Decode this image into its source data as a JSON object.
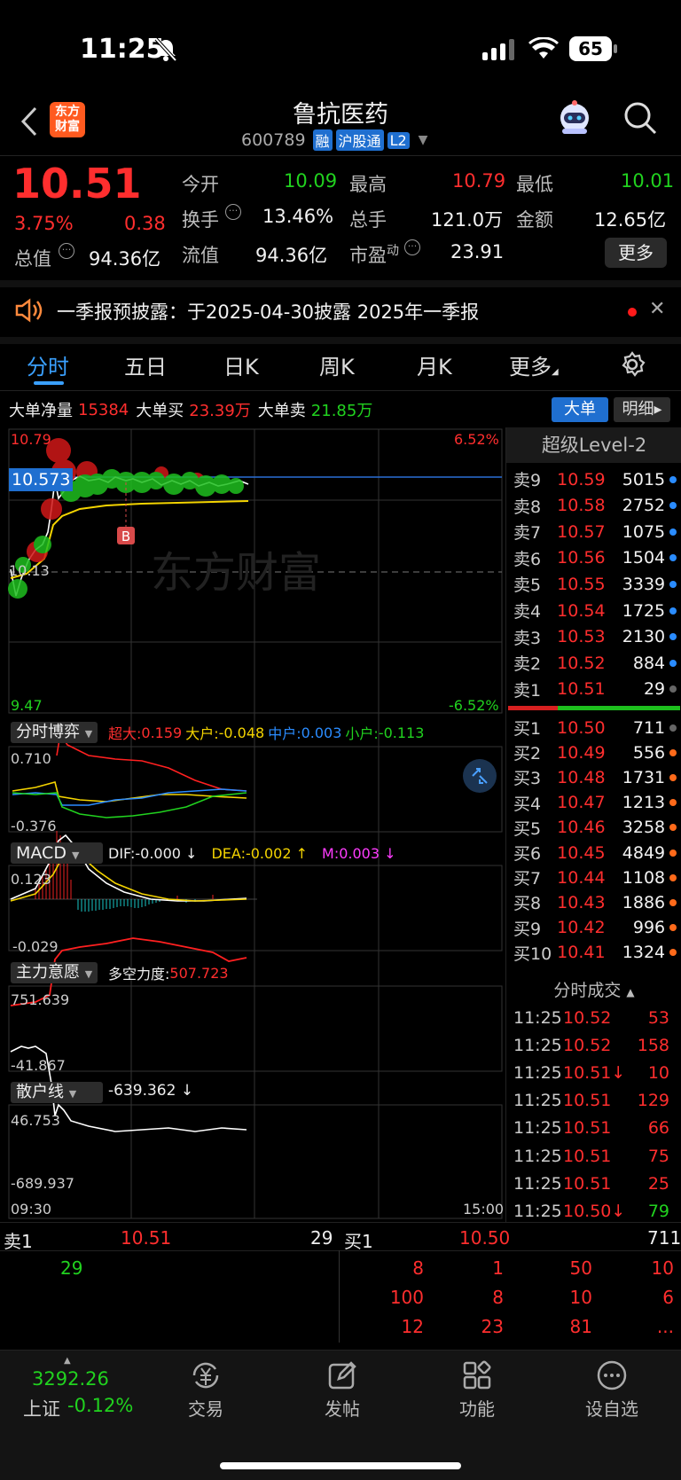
{
  "status_bar": {
    "time": "11:25",
    "battery": "65"
  },
  "header": {
    "title": "鲁抗医药",
    "code": "600789",
    "badge_rong": "融",
    "badge_hgt": "沪股通",
    "badge_l2": "L2",
    "logo_text": "东方财富"
  },
  "quote": {
    "price": "10.51",
    "change_pct": "3.75%",
    "change": "0.38",
    "open_label": "今开",
    "open": "10.09",
    "high_label": "最高",
    "high": "10.79",
    "low_label": "最低",
    "low": "10.01",
    "turnover_label": "换手",
    "turnover": "13.46%",
    "volume_label": "总手",
    "volume": "121.0万",
    "amount_label": "金额",
    "amount": "12.65亿",
    "mktcap_label": "总值",
    "mktcap": "94.36亿",
    "float_label": "流值",
    "float": "94.36亿",
    "pe_label": "市盈",
    "pe_sup": "动",
    "pe": "23.91",
    "more_label": "更多"
  },
  "notice": {
    "text": "一季报预披露：于2025-04-30披露 2025年一季报"
  },
  "tabs": [
    "分时",
    "五日",
    "日K",
    "周K",
    "月K",
    "更多"
  ],
  "bigorder": {
    "net_label": "大单净量",
    "net": "15384",
    "buy_label": "大单买",
    "buy": "23.39万",
    "sell_label": "大单卖",
    "sell": "21.85万",
    "btn_big": "大单",
    "btn_detail": "明细"
  },
  "chart": {
    "high_price": "10.79",
    "low_price": "9.47",
    "high_pct": "6.52%",
    "low_pct": "-6.52%",
    "cursor_price": "10.573",
    "base_price": "10.13",
    "watermark": "东方财富",
    "marker_b": "B",
    "time_start": "09:30",
    "time_end": "15:00"
  },
  "panel_fsbz": {
    "label": "分时博弈",
    "super_label": "超大:",
    "super": "0.159",
    "big_label": "大户:",
    "big": "-0.048",
    "mid_label": "中户:",
    "mid": "0.003",
    "small_label": "小户:",
    "small": "-0.113",
    "max": "0.710",
    "min": "-0.376"
  },
  "panel_macd": {
    "label": "MACD",
    "dif": "DIF:-0.000 ↓",
    "dea": "DEA:-0.002 ↑",
    "m": "M:0.003 ↓",
    "max": "0.123",
    "min": "-0.029"
  },
  "panel_zlyy": {
    "label": "主力意愿",
    "force_label": "多空力度:",
    "force": "507.723",
    "max": "751.639",
    "min": "-41.867"
  },
  "panel_shx": {
    "label": "散户线",
    "value": "-639.362 ↓",
    "max": "46.753",
    "min": "-689.937"
  },
  "level2": {
    "title": "超级Level-2"
  },
  "asks": [
    {
      "label": "卖9",
      "price": "10.59",
      "vol": "5015"
    },
    {
      "label": "卖8",
      "price": "10.58",
      "vol": "2752"
    },
    {
      "label": "卖7",
      "price": "10.57",
      "vol": "1075"
    },
    {
      "label": "卖6",
      "price": "10.56",
      "vol": "1504"
    },
    {
      "label": "卖5",
      "price": "10.55",
      "vol": "3339"
    },
    {
      "label": "卖4",
      "price": "10.54",
      "vol": "1725"
    },
    {
      "label": "卖3",
      "price": "10.53",
      "vol": "2130"
    },
    {
      "label": "卖2",
      "price": "10.52",
      "vol": "884"
    },
    {
      "label": "卖1",
      "price": "10.51",
      "vol": "29"
    }
  ],
  "bids": [
    {
      "label": "买1",
      "price": "10.50",
      "vol": "711"
    },
    {
      "label": "买2",
      "price": "10.49",
      "vol": "556"
    },
    {
      "label": "买3",
      "price": "10.48",
      "vol": "1731"
    },
    {
      "label": "买4",
      "price": "10.47",
      "vol": "1213"
    },
    {
      "label": "买5",
      "price": "10.46",
      "vol": "3258"
    },
    {
      "label": "买6",
      "price": "10.45",
      "vol": "4849"
    },
    {
      "label": "买7",
      "price": "10.44",
      "vol": "1108"
    },
    {
      "label": "买8",
      "price": "10.43",
      "vol": "1886"
    },
    {
      "label": "买9",
      "price": "10.42",
      "vol": "996"
    },
    {
      "label": "买10",
      "price": "10.41",
      "vol": "1324"
    }
  ],
  "trades_title": "分时成交",
  "trades": [
    {
      "time": "11:25",
      "price": "10.52",
      "vol": "53"
    },
    {
      "time": "11:25",
      "price": "10.52",
      "vol": "158"
    },
    {
      "time": "11:25",
      "price": "10.51↓",
      "vol": "10"
    },
    {
      "time": "11:25",
      "price": "10.51",
      "vol": "129"
    },
    {
      "time": "11:25",
      "price": "10.51",
      "vol": "66"
    },
    {
      "time": "11:25",
      "price": "10.51",
      "vol": "75"
    },
    {
      "time": "11:25",
      "price": "10.51",
      "vol": "25"
    },
    {
      "time": "11:25",
      "price": "10.50↓",
      "vol": "79"
    }
  ],
  "queue": {
    "sell_label": "卖1",
    "sell_price": "10.51",
    "sell_vol": "29",
    "buy_label": "买1",
    "buy_price": "10.50",
    "buy_vol": "711",
    "sell_orders": [
      "29"
    ],
    "buy_orders": [
      "8",
      "1",
      "50",
      "10",
      "100",
      "8",
      "10",
      "6",
      "12",
      "23",
      "81",
      "..."
    ]
  },
  "bottom": {
    "index_value": "3292.26",
    "index_name": "上证",
    "index_change": "-0.12%",
    "trade": "交易",
    "post": "发帖",
    "func": "功能",
    "watch": "设自选"
  }
}
